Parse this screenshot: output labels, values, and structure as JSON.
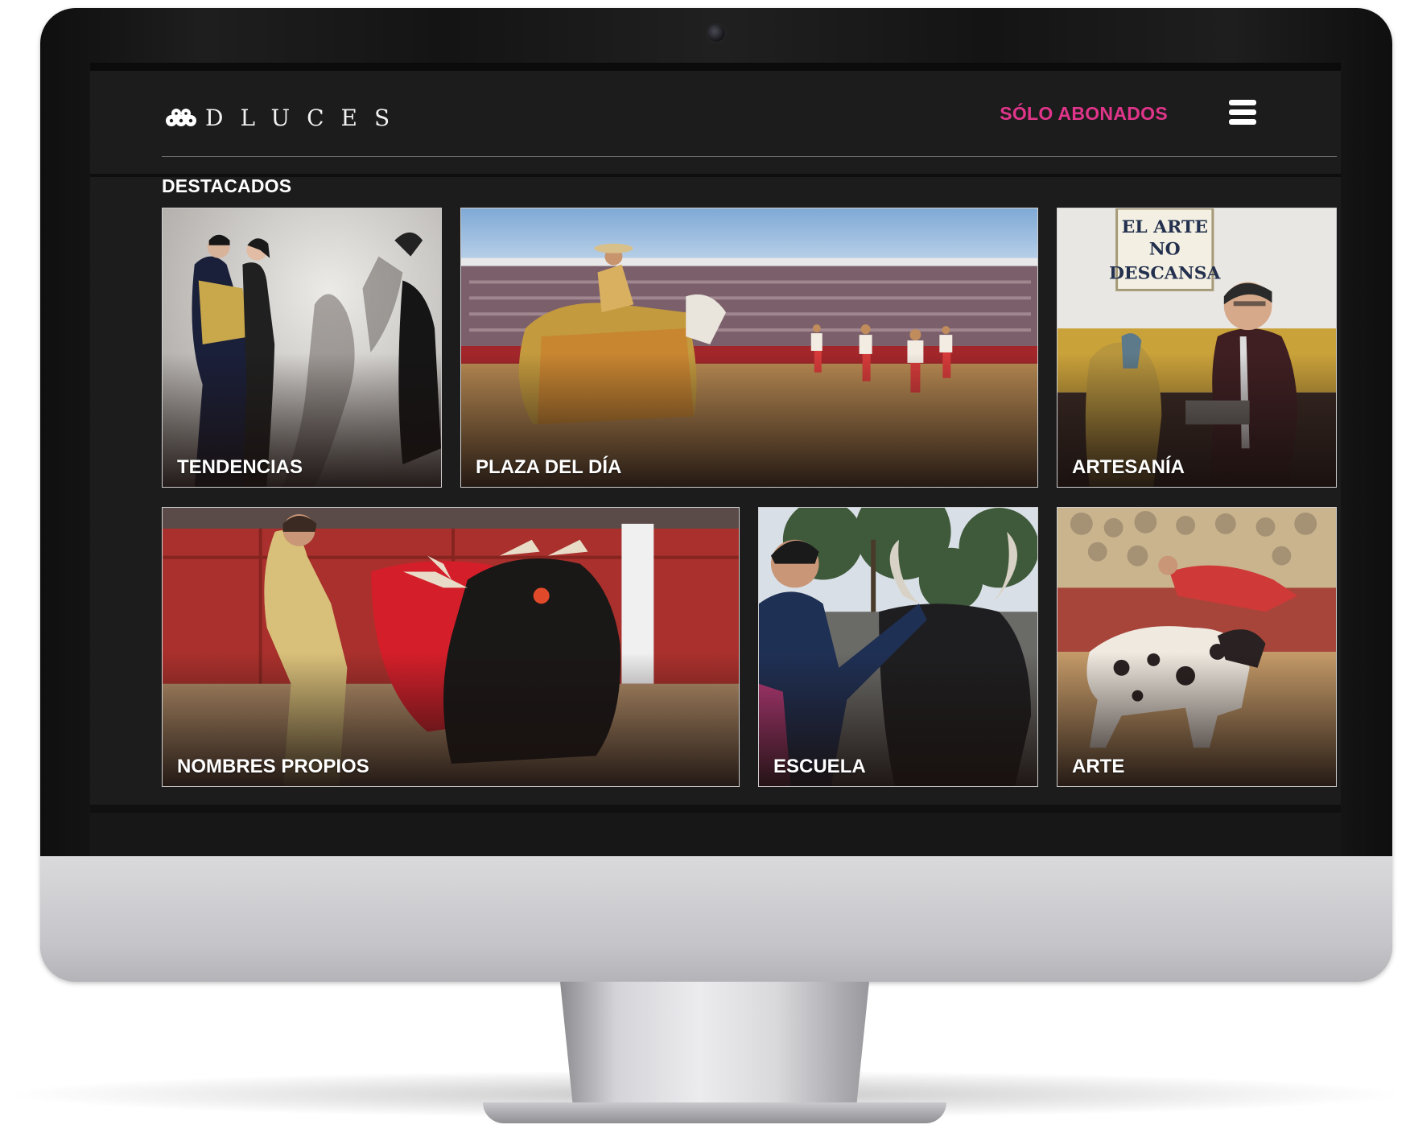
{
  "site": {
    "logo_text": "DLUCES",
    "member_link": "SÓLO ABONADOS"
  },
  "section": {
    "title": "DESTACADOS"
  },
  "tiles": [
    {
      "label": "TENDENCIAS"
    },
    {
      "label": "PLAZA DEL DÍA"
    },
    {
      "label": "ARTESANÍA"
    },
    {
      "label": "NOMBRES PROPIOS"
    },
    {
      "label": "ESCUELA"
    },
    {
      "label": "ARTE"
    }
  ],
  "sign_text": [
    "EL ARTE",
    "NO",
    "DESCANSA"
  ],
  "colors": {
    "accent": "#e0358a",
    "screen_bg": "#1c1c1c",
    "label": "#ffffff"
  },
  "icons": [
    "logo-mark-icon",
    "hamburger-menu-icon"
  ]
}
